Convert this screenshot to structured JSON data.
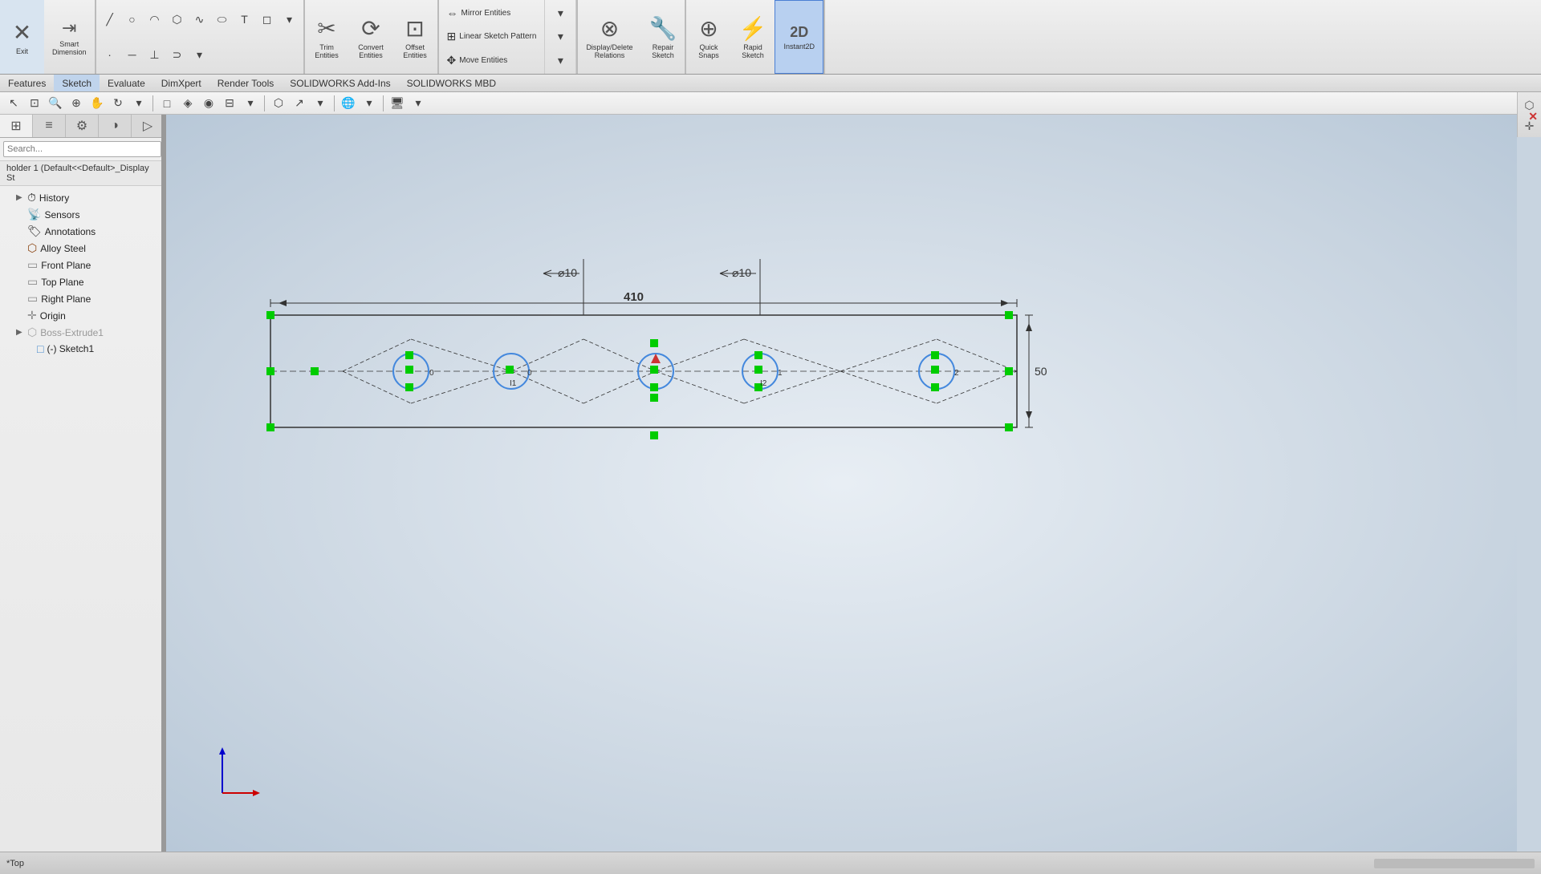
{
  "toolbar": {
    "groups": [
      {
        "id": "exit",
        "icon": "✕",
        "label": "Exit"
      },
      {
        "id": "smart-dimension",
        "icon": "📐",
        "label": "Smart\nDimension"
      },
      {
        "id": "trim-entities",
        "icon": "✂",
        "label": "Trim\nEntities"
      },
      {
        "id": "convert-entities",
        "icon": "◈",
        "label": "Convert\nEntities"
      },
      {
        "id": "offset-entities",
        "icon": "⊡",
        "label": "Offset\nEntities"
      },
      {
        "id": "mirror-entities",
        "icon": "⇔",
        "label": "Mirror Entities"
      },
      {
        "id": "linear-sketch",
        "icon": "⊞",
        "label": "Linear Sketch Pattern"
      },
      {
        "id": "move-entities",
        "icon": "✥",
        "label": "Move Entities"
      },
      {
        "id": "display-delete",
        "icon": "⊗",
        "label": "Display/Delete\nRelations"
      },
      {
        "id": "repair-sketch",
        "icon": "🔧",
        "label": "Repair\nSketch"
      },
      {
        "id": "quick-snaps",
        "icon": "⊕",
        "label": "Quick\nSnaps"
      },
      {
        "id": "rapid-sketch",
        "icon": "⚡",
        "label": "Rapid\nSketch"
      },
      {
        "id": "instant2d",
        "icon": "2D",
        "label": "Instant2D",
        "active": true
      }
    ]
  },
  "menubar": {
    "items": [
      "Features",
      "Sketch",
      "Evaluate",
      "DimXpert",
      "Render Tools",
      "SOLIDWORKS Add-Ins",
      "SOLIDWORKS MBD"
    ]
  },
  "sidebar": {
    "tree_header": "holder 1  (Default<<Default>_Display St",
    "items": [
      {
        "id": "history",
        "label": "History",
        "icon": "⏱",
        "indent": 1,
        "arrow": "▶"
      },
      {
        "id": "sensors",
        "label": "Sensors",
        "icon": "📡",
        "indent": 1,
        "arrow": ""
      },
      {
        "id": "annotations",
        "label": "Annotations",
        "icon": "🏷",
        "indent": 1,
        "arrow": ""
      },
      {
        "id": "alloy-steel",
        "label": "Alloy Steel",
        "icon": "⬡",
        "indent": 1,
        "arrow": ""
      },
      {
        "id": "front-plane",
        "label": "Front Plane",
        "icon": "▭",
        "indent": 1,
        "arrow": ""
      },
      {
        "id": "top-plane",
        "label": "Top Plane",
        "icon": "▭",
        "indent": 1,
        "arrow": ""
      },
      {
        "id": "right-plane",
        "label": "Right Plane",
        "icon": "▭",
        "indent": 1,
        "arrow": ""
      },
      {
        "id": "origin",
        "label": "Origin",
        "icon": "✛",
        "indent": 1,
        "arrow": ""
      },
      {
        "id": "boss-extrude1",
        "label": "Boss-Extrude1",
        "icon": "⬡",
        "indent": 1,
        "arrow": "▶",
        "dimmed": true
      },
      {
        "id": "sketch1",
        "label": "(-) Sketch1",
        "icon": "□",
        "indent": 2,
        "arrow": ""
      }
    ]
  },
  "sketch": {
    "dim_410": "410",
    "dim_50": "50",
    "dim_10_left": "⌀10",
    "dim_10_right": "⌀10",
    "circle_labels": [
      "0",
      "0",
      "1",
      "2"
    ],
    "node_labels": [
      "I1",
      "I2"
    ]
  },
  "statusbar": {
    "view_label": "*Top"
  },
  "canvas": {
    "bg_from": "#e8eef4",
    "bg_to": "#b8c8d8"
  }
}
